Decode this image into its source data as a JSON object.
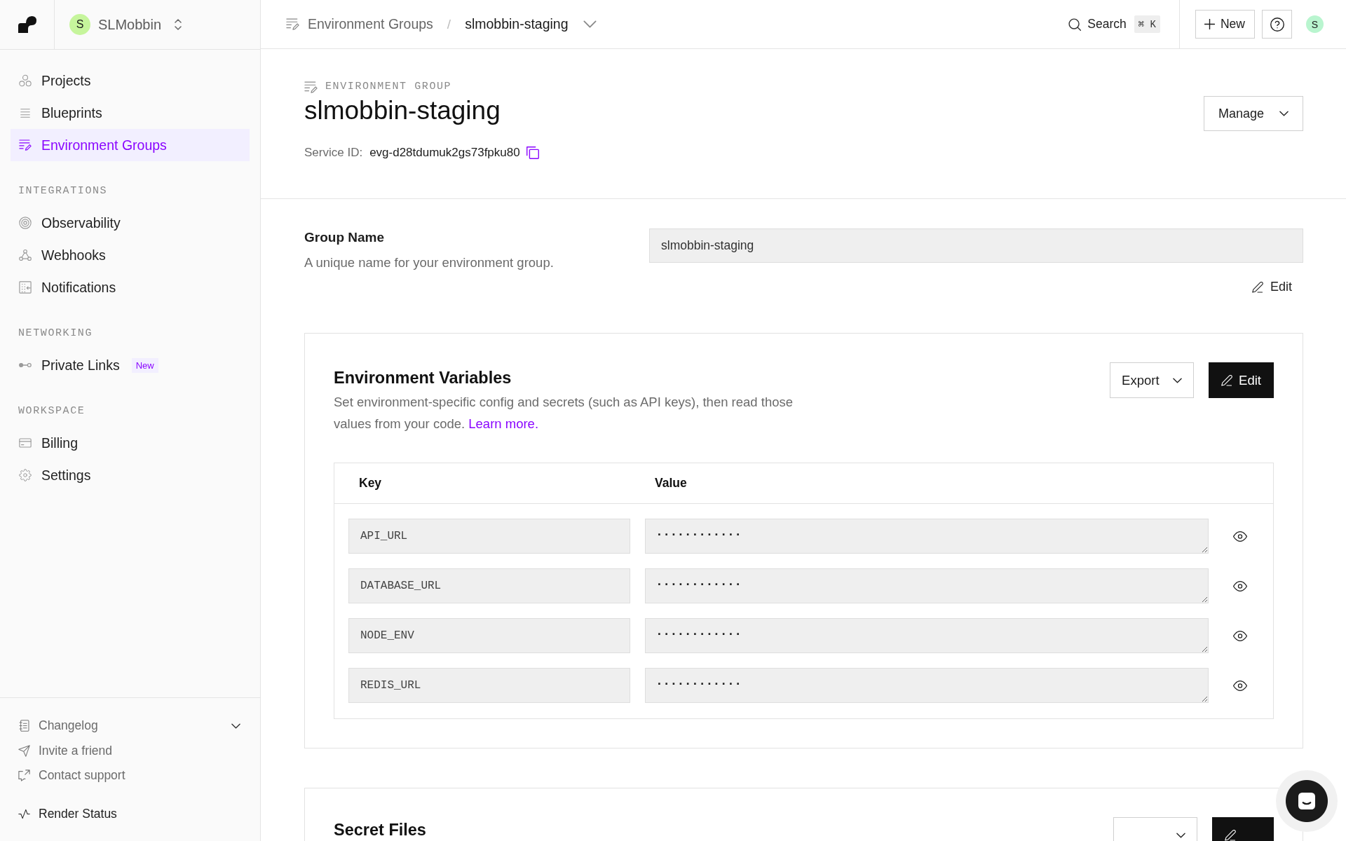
{
  "sidebar": {
    "workspace": {
      "initial": "S",
      "name": "SLMobbin"
    },
    "nav_items": [
      {
        "label": "Projects",
        "selected": false
      },
      {
        "label": "Blueprints",
        "selected": false
      },
      {
        "label": "Environment Groups",
        "selected": true
      }
    ],
    "sections": [
      {
        "heading": "INTEGRATIONS",
        "items": [
          {
            "label": "Observability",
            "selected": false
          },
          {
            "label": "Webhooks",
            "selected": false
          },
          {
            "label": "Notifications",
            "selected": false
          }
        ]
      },
      {
        "heading": "NETWORKING",
        "items": [
          {
            "label": "Private Links",
            "selected": false,
            "badge": "New"
          }
        ]
      },
      {
        "heading": "WORKSPACE",
        "items": [
          {
            "label": "Billing",
            "selected": false
          },
          {
            "label": "Settings",
            "selected": false
          }
        ]
      }
    ],
    "changelog": {
      "label": "Changelog",
      "expanded": false
    },
    "footer_links": [
      {
        "label": "Invite a friend"
      },
      {
        "label": "Contact support"
      }
    ],
    "status_link": "Render Status"
  },
  "topbar": {
    "breadcrumb": [
      "Environment Groups",
      "slmobbin-staging"
    ],
    "separator": "/",
    "search": {
      "label": "Search",
      "shortcut": "⌘ K"
    },
    "new_button": "New",
    "avatar_initial": "S"
  },
  "header": {
    "eyebrow": "ENVIRONMENT GROUP",
    "title": "slmobbin-staging",
    "service_id": {
      "label": "Service ID:",
      "value": "evg-d28tdumuk2gs73fpku80"
    },
    "manage_button": "Manage"
  },
  "group_name": {
    "title": "Group Name",
    "description": "A unique name for your environment group.",
    "value": "slmobbin-staging",
    "edit_button": "Edit"
  },
  "environment_variables": {
    "title": "Environment Variables",
    "description": "Set environment-specific config and secrets (such as API keys), then read those values from your code.",
    "link": "Learn more.",
    "export_button": "Export",
    "edit_button": "Edit",
    "columns": [
      "Key",
      "Value"
    ],
    "rows": [
      {
        "key": "API_URL",
        "value": "············"
      },
      {
        "key": "DATABASE_URL",
        "value": "············"
      },
      {
        "key": "NODE_ENV",
        "value": "············"
      },
      {
        "key": "REDIS_URL",
        "value": "············"
      }
    ]
  },
  "secret_files": {
    "title": "Secret Files"
  }
}
